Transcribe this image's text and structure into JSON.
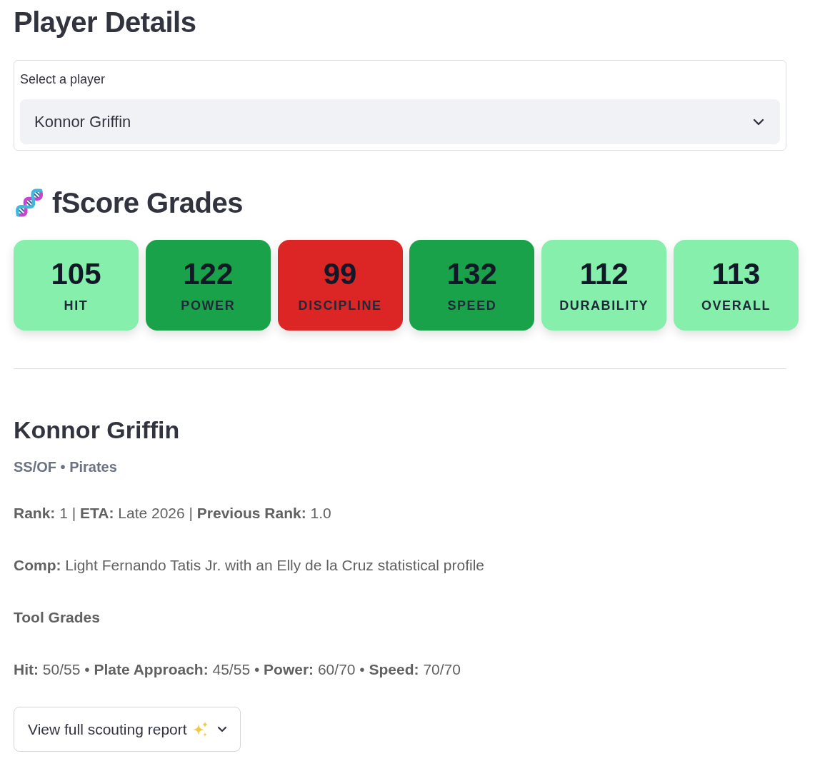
{
  "page_title": "Player Details",
  "player_select": {
    "label": "Select a player",
    "value": "Konnor Griffin"
  },
  "grades_section": {
    "title": "fScore Grades",
    "cards": [
      {
        "value": "105",
        "label": "HIT",
        "color": "#86efac"
      },
      {
        "value": "122",
        "label": "POWER",
        "color": "#1aa24a"
      },
      {
        "value": "99",
        "label": "DISCIPLINE",
        "color": "#dc2626"
      },
      {
        "value": "132",
        "label": "SPEED",
        "color": "#1aa24a"
      },
      {
        "value": "112",
        "label": "DURABILITY",
        "color": "#86efac"
      },
      {
        "value": "113",
        "label": "OVERALL",
        "color": "#86efac"
      }
    ]
  },
  "player": {
    "name": "Konnor Griffin",
    "subtitle": "SS/OF • Pirates",
    "rank_line": "**Rank:** 1 | **ETA:** Late 2026 | **Previous Rank:** 1.0",
    "comp_line": "**Comp:** Light Fernando Tatis Jr. with an Elly de la Cruz statistical profile",
    "tool_grades_title": "Tool Grades",
    "tool_grades_line": "**Hit:** 50/55 • **Plate Approach:** 45/55 • **Power:** 60/70 • **Speed:** 70/70"
  },
  "report_expander": {
    "label": "View full scouting report",
    "expanded": false
  }
}
